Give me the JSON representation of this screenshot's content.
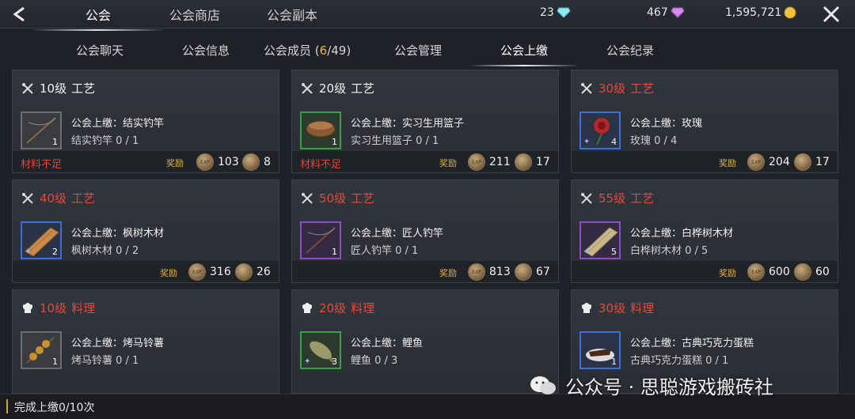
{
  "header": {
    "tabs": [
      {
        "label": "公会"
      },
      {
        "label": "公会商店"
      },
      {
        "label": "公会副本"
      }
    ],
    "currencies": [
      {
        "value": "23",
        "icon": "diamond-cyan-icon"
      },
      {
        "value": "467",
        "icon": "diamond-purple-icon"
      },
      {
        "value": "1,595,721",
        "icon": "gold-coin-icon"
      }
    ]
  },
  "subtabs": {
    "chat": "公会聊天",
    "info": "公会信息",
    "members_label": "公会成员",
    "members_open": " (",
    "members_current": "6",
    "members_total": "/49)",
    "manage": "公会管理",
    "contribute": "公会上缴",
    "records": "公会纪录"
  },
  "cards": [
    {
      "level": "10级",
      "category": "工艺",
      "title": "公会上缴：结实钓竿",
      "progress": "结实钓竿 0 / 1",
      "qty": "1",
      "status": "材料不足",
      "reward_label": "奖励",
      "exp": "103",
      "coin": "8"
    },
    {
      "level": "20级",
      "category": "工艺",
      "title": "公会上缴：实习生用篮子",
      "progress": "实习生用篮子 0 / 1",
      "qty": "1",
      "status": "材料不足",
      "reward_label": "奖励",
      "exp": "211",
      "coin": "17"
    },
    {
      "level": "30级",
      "category": "工艺",
      "title": "公会上缴：玫瑰",
      "progress": "玫瑰 0 / 4",
      "qty": "4",
      "status": "",
      "reward_label": "奖励",
      "exp": "204",
      "coin": "17"
    },
    {
      "level": "40级",
      "category": "工艺",
      "title": "公会上缴：枫树木材",
      "progress": "枫树木材 0 / 2",
      "qty": "2",
      "status": "",
      "reward_label": "奖励",
      "exp": "316",
      "coin": "26"
    },
    {
      "level": "50级",
      "category": "工艺",
      "title": "公会上缴：匠人钓竿",
      "progress": "匠人钓竿 0 / 1",
      "qty": "1",
      "status": "",
      "reward_label": "奖励",
      "exp": "813",
      "coin": "67"
    },
    {
      "level": "55级",
      "category": "工艺",
      "title": "公会上缴：白桦树木材",
      "progress": "白桦树木材 0 / 5",
      "qty": "5",
      "status": "",
      "reward_label": "奖励",
      "exp": "600",
      "coin": "60"
    },
    {
      "level": "10级",
      "category": "料理",
      "title": "公会上缴：烤马铃薯",
      "progress": "烤马铃薯 0 / 1",
      "qty": "1",
      "status": "",
      "reward_label": "",
      "exp": "",
      "coin": ""
    },
    {
      "level": "20级",
      "category": "料理",
      "title": "公会上缴：鲤鱼",
      "progress": "鲤鱼 0 / 3",
      "qty": "3",
      "status": "",
      "reward_label": "",
      "exp": "",
      "coin": ""
    },
    {
      "level": "30级",
      "category": "料理",
      "title": "公会上缴：古典巧克力蛋糕",
      "progress": "古典巧克力蛋糕 0 / 1",
      "qty": "1",
      "status": "",
      "reward_label": "",
      "exp": "",
      "coin": ""
    }
  ],
  "footer": {
    "status": "完成上缴0/10次"
  },
  "watermark": {
    "text": "公众号 · 思聪游戏搬砖社"
  },
  "colors": {
    "accent_gold": "#e7b64a",
    "warning_red": "#e24b3c",
    "background": "#1e2127"
  }
}
